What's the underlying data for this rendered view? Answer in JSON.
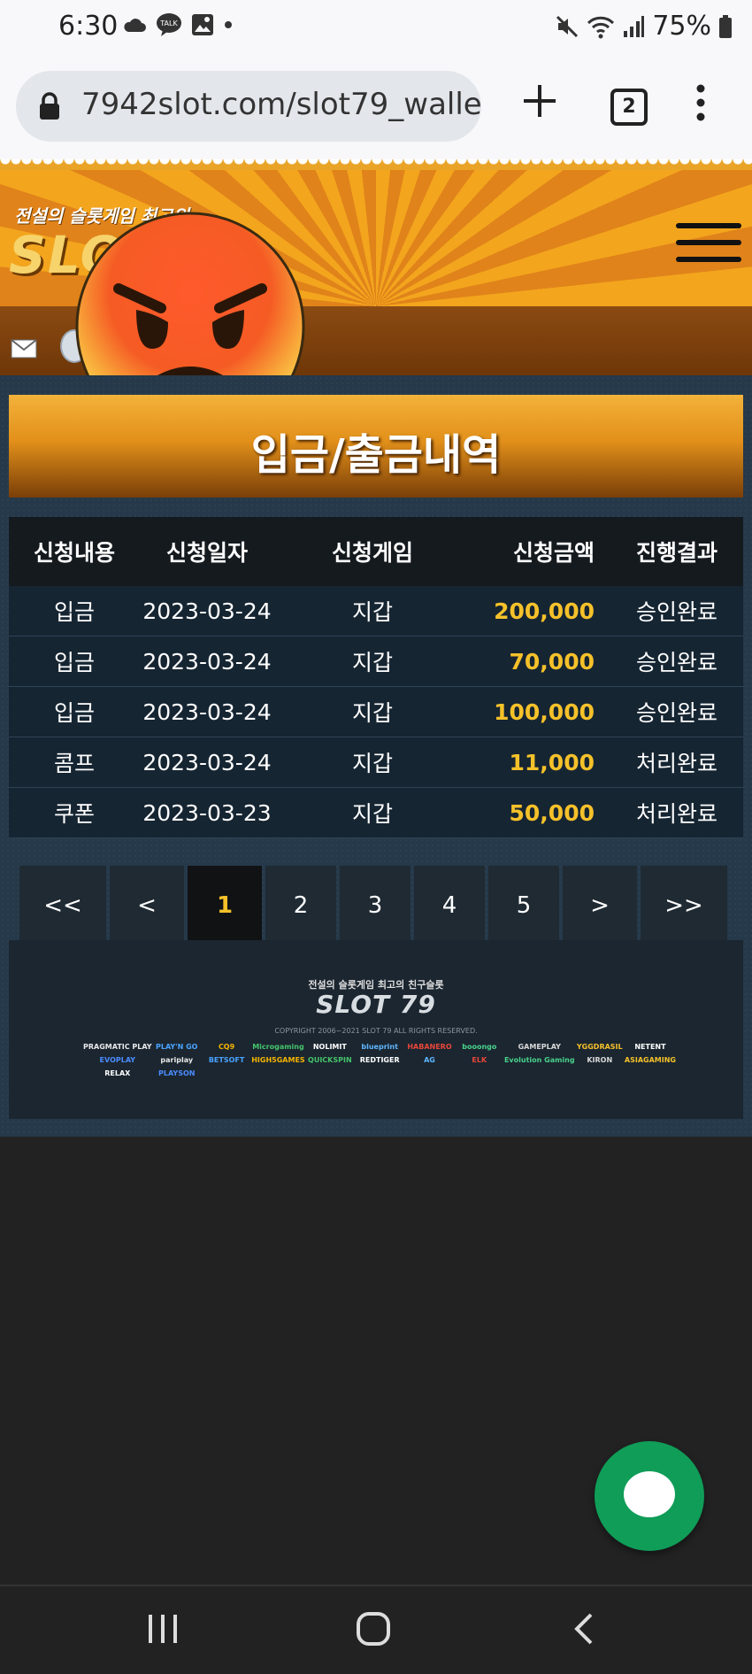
{
  "status_bar": {
    "time": "6:30",
    "battery": "75%"
  },
  "browser": {
    "url": "7942slot.com/slot79_walle",
    "tab_count": "2"
  },
  "header": {
    "logo_tagline": "전설의 슬롯게임 최고의",
    "logo_text": "SLOT"
  },
  "page": {
    "title": "입금/출금내역"
  },
  "table": {
    "headers": [
      "신청내용",
      "신청일자",
      "신청게임",
      "신청금액",
      "진행결과"
    ],
    "rows": [
      [
        "입금",
        "2023-03-24",
        "지갑",
        "200,000",
        "승인완료"
      ],
      [
        "입금",
        "2023-03-24",
        "지갑",
        "70,000",
        "승인완료"
      ],
      [
        "입금",
        "2023-03-24",
        "지갑",
        "100,000",
        "승인완료"
      ],
      [
        "콤프",
        "2023-03-24",
        "지갑",
        "11,000",
        "처리완료"
      ],
      [
        "쿠폰",
        "2023-03-23",
        "지갑",
        "50,000",
        "처리완료"
      ]
    ]
  },
  "pagination": {
    "items": [
      "<<",
      "<",
      "1",
      "2",
      "3",
      "4",
      "5",
      ">",
      ">>"
    ],
    "active": "1"
  },
  "footer": {
    "tagline": "전설의 슬롯게임 최고의 친구슬롯",
    "logo": "SLOT 79",
    "copyright": "COPYRIGHT 2006~2021 SLOT 79 ALL RIGHTS RESERVED.",
    "brands": [
      "PRAGMATIC PLAY",
      "PLAY'N GO",
      "CQ9",
      "Microgaming",
      "NOLIMIT",
      "blueprint",
      "HABANERO",
      "booongo",
      "GAMEPLAY",
      "YGGDRASIL",
      "NETENT",
      "EVOPLAY",
      "pariplay",
      "BETSOFT",
      "HIGH5GAMES",
      "QUICKSPIN",
      "REDTIGER",
      "AG",
      "ELK",
      "Evolution Gaming",
      "KIRON",
      "ASIAGAMING",
      "RELAX",
      "PLAYSON"
    ]
  },
  "colors": {
    "accent": "#f5c12a",
    "banner": "#f0a020",
    "fab": "#0f9d58"
  }
}
